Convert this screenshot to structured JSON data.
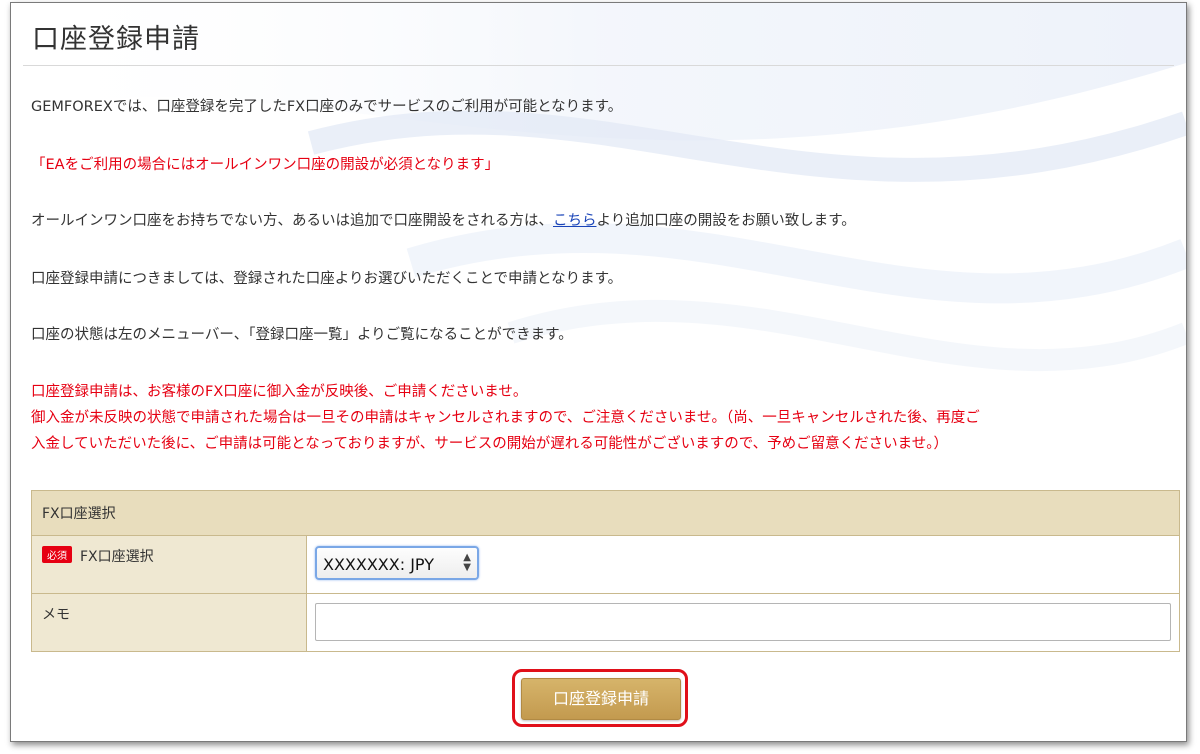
{
  "page": {
    "title": "口座登録申請"
  },
  "intro": {
    "line1": "GEMFOREXでは、口座登録を完了したFX口座のみでサービスのご利用が可能となります。",
    "ea_warning": "「EAをご利用の場合にはオールインワン口座の開設が必須となります」",
    "line3_before_link": "オールインワン口座をお持ちでない方、あるいは追加で口座開設をされる方は、",
    "line3_link": "こちら",
    "line3_after_link": "より追加口座の開設をお願い致します。",
    "line4": "口座登録申請につきましては、登録された口座よりお選びいただくことで申請となります。",
    "line5": "口座の状態は左のメニューバー、「登録口座一覧」よりご覧になることができます。"
  },
  "notice": {
    "line1": "口座登録申請は、お客様のFX口座に御入金が反映後、ご申請くださいませ。",
    "line2": "御入金が未反映の状態で申請された場合は一旦その申請はキャンセルされますので、ご注意くださいませ。（尚、一旦キャンセルされた後、再度ご",
    "line3": "入金していただいた後に、ご申請は可能となっておりますが、サービスの開始が遅れる可能性がございますので、予めご留意くださいませ。）"
  },
  "form": {
    "section_title": "FX口座選択",
    "required_badge": "必須",
    "account_label": "FX口座選択",
    "account_selected": "XXXXXXX: JPY",
    "memo_label": "メモ",
    "memo_value": ""
  },
  "actions": {
    "submit_label": "口座登録申請"
  },
  "colors": {
    "warning_red": "#e60012",
    "link_blue": "#1a44b8",
    "table_header": "#e8ddbd",
    "button_gold": "#c9a55a",
    "highlight_red": "#e0101a"
  }
}
